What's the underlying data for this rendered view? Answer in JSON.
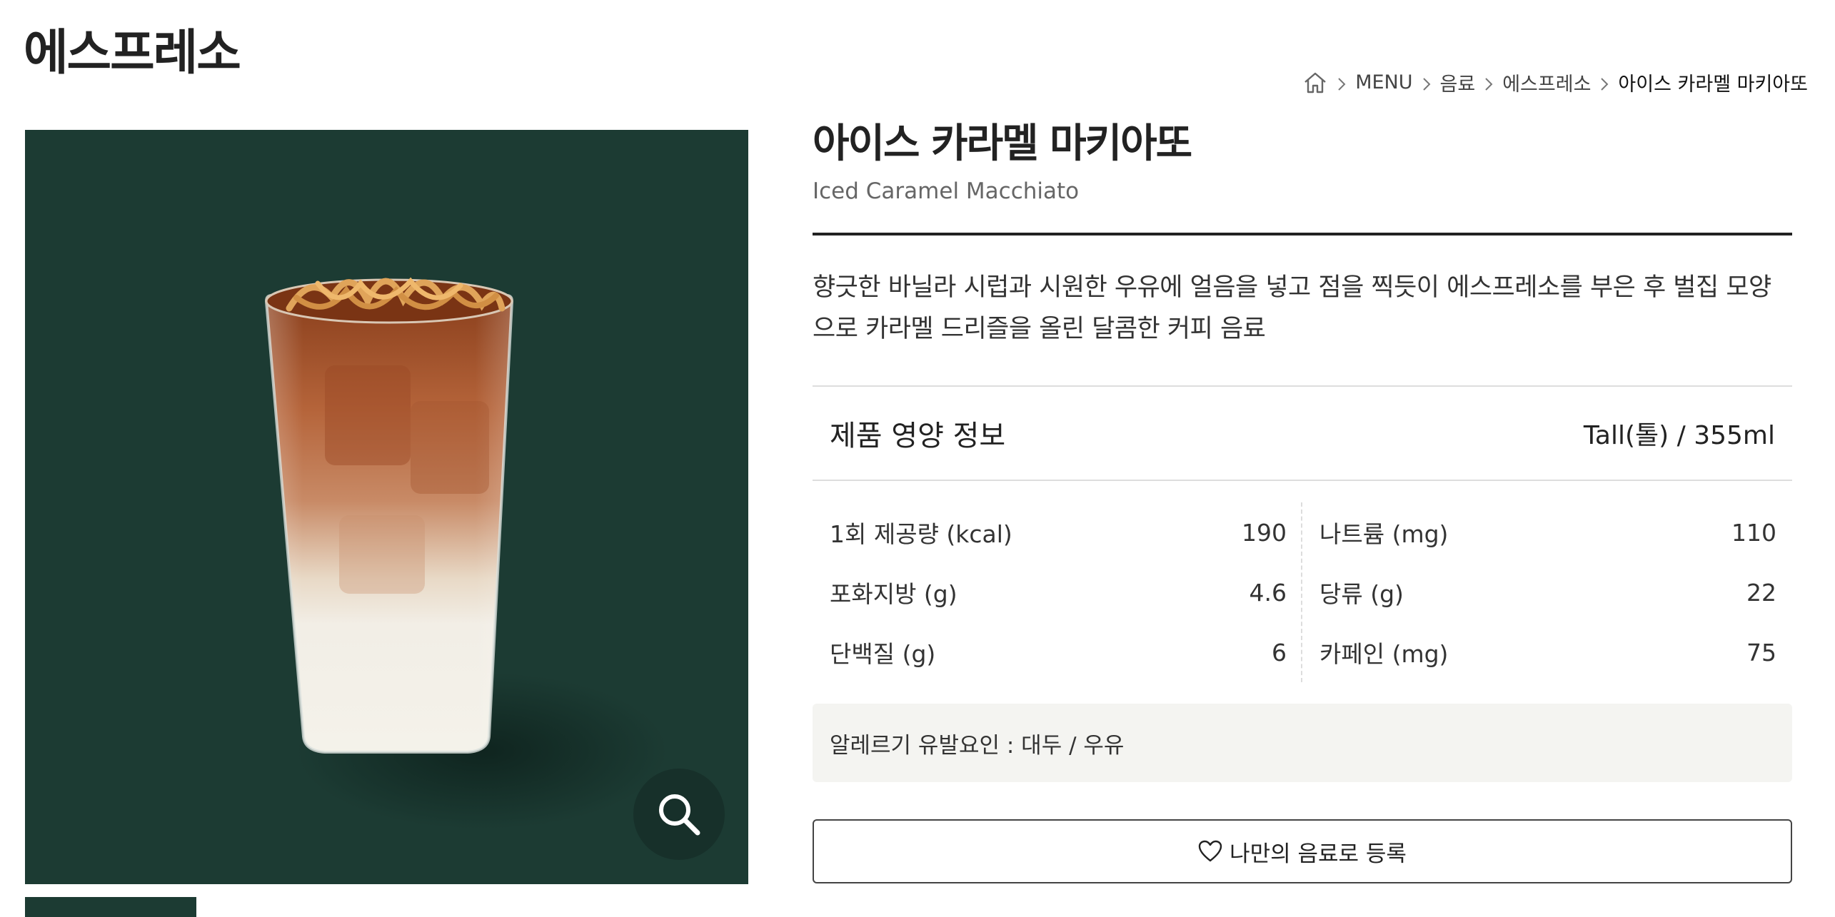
{
  "page": {
    "title": "에스프레소"
  },
  "breadcrumb": {
    "home_icon": "home-icon",
    "items": [
      "MENU",
      "음료",
      "에스프레소",
      "아이스 카라멜 마키아또"
    ]
  },
  "product": {
    "name_ko": "아이스 카라멜 마키아또",
    "name_en": "Iced Caramel Macchiato",
    "description": "향긋한 바닐라 시럽과 시원한 우유에 얼음을 넣고 점을 찍듯이 에스프레소를 부은 후 벌집 모양으로 카라멜 드리즐을 올린 달콤한 커피 음료",
    "image_bg": "#1c3b33",
    "zoom_icon": "search-icon"
  },
  "nutrition": {
    "heading": "제품 영양 정보",
    "size": "Tall(톨) / 355ml",
    "left": [
      {
        "label": "1회 제공량 (kcal)",
        "value": "190"
      },
      {
        "label": "포화지방 (g)",
        "value": "4.6"
      },
      {
        "label": "단백질 (g)",
        "value": "6"
      }
    ],
    "right": [
      {
        "label": "나트륨 (mg)",
        "value": "110"
      },
      {
        "label": "당류 (g)",
        "value": "22"
      },
      {
        "label": "카페인 (mg)",
        "value": "75"
      }
    ]
  },
  "allergy": {
    "label": "알레르기 유발요인 :",
    "text": "대두 / 우유"
  },
  "favorite": {
    "icon": "heart-icon",
    "label": "나만의 음료로 등록"
  }
}
